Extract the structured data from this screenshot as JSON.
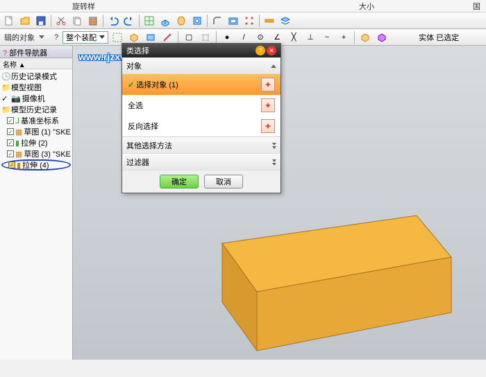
{
  "menubar": {
    "item1": "旋转样",
    "item2": "大小",
    "item3": "国"
  },
  "toolbar2": {
    "filter_label": "过滤器",
    "assembly_combo": "整个装配",
    "status": "实体 已选定"
  },
  "sidebar": {
    "title": "部件导航器",
    "header": "名称 ▲",
    "edit_target": "辑的对象",
    "items": [
      {
        "label": "历史记录模式",
        "icon": "history"
      },
      {
        "label": "模型视图",
        "icon": "folder"
      },
      {
        "label": "摄像机",
        "icon": "camera"
      },
      {
        "label": "模型历史记录",
        "icon": "folder"
      },
      {
        "label": "基准坐标系",
        "icon": "csys",
        "checked": true,
        "suffix": "..."
      },
      {
        "label": "草图 (1) \"SKE",
        "icon": "sketch",
        "checked": true
      },
      {
        "label": "拉伸 (2)",
        "icon": "extrude",
        "checked": true
      },
      {
        "label": "草图 (3) \"SKE",
        "icon": "sketch",
        "checked": true
      },
      {
        "label": "拉伸 (4)",
        "icon": "extrude",
        "checked": true,
        "circled": true
      }
    ]
  },
  "dialog": {
    "title": "类选择",
    "sec_object": "对象",
    "row_select": "选择对象 (1)",
    "row_all": "全选",
    "row_invert": "反向选择",
    "sec_other": "其他选择方法",
    "sec_filter": "过滤器",
    "ok": "确定",
    "cancel": "取消"
  },
  "watermark": "www.rjzxw.com",
  "colors": {
    "solid_top": "#f4b843",
    "solid_side": "#d89a2e",
    "solid_front": "#e8a838"
  }
}
